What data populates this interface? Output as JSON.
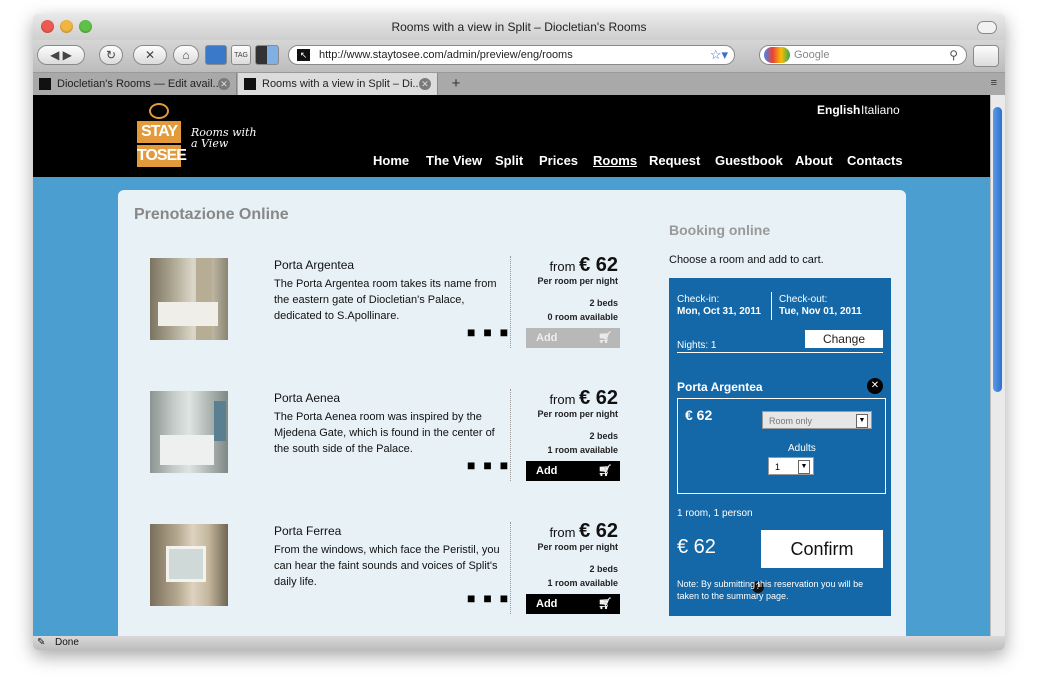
{
  "browser": {
    "window_title": "Rooms with a view in Split – Diocletian's Rooms",
    "url": "http://www.staytosee.com/admin/preview/eng/rooms",
    "search_placeholder": "Google",
    "tabs": [
      {
        "label": "Diocletian's Rooms — Edit avail..."
      },
      {
        "label": "Rooms with a view in Split – Di..."
      }
    ],
    "tab_add": "+",
    "status": "Done"
  },
  "site": {
    "logo_line1": "STAY",
    "logo_line2": "TOSEE",
    "tagline": "Rooms with a View",
    "languages": [
      "English",
      "Italiano"
    ],
    "nav": [
      "Home",
      "The View",
      "Split",
      "Prices",
      "Rooms",
      "Request",
      "Guestbook",
      "About",
      "Contacts"
    ],
    "nav_active": "Rooms"
  },
  "main": {
    "heading": "Prenotazione Online",
    "rooms": [
      {
        "name": "Porta Argentea",
        "desc": "The Porta Argentea room takes its name from the eastern gate of Diocletian's Palace, dedicated to S.Apollinare.",
        "from_label": "from",
        "price": "€ 62",
        "per": "Per room per night",
        "beds": "2 beds",
        "available": "0 room available",
        "add": "Add",
        "disabled": true
      },
      {
        "name": "Porta Aenea",
        "desc": "The Porta Aenea room was inspired by the Mjedena Gate, which is found in the center of the south side of the Palace.",
        "from_label": "from",
        "price": "€ 62",
        "per": "Per room per night",
        "beds": "2 beds",
        "available": "1 room available",
        "add": "Add",
        "disabled": false
      },
      {
        "name": "Porta Ferrea",
        "desc": "From the windows, which face the Peristil, you can hear the faint sounds and voices of Split's daily life.",
        "from_label": "from",
        "price": "€ 62",
        "per": "Per room per night",
        "beds": "2 beds",
        "available": "1 room available",
        "add": "Add",
        "disabled": false
      }
    ],
    "more": "■ ■ ■"
  },
  "booking": {
    "title": "Booking online",
    "subtitle": "Choose a room and add to cart.",
    "checkin_label": "Check-in:",
    "checkin_date": "Mon, Oct 31, 2011",
    "checkout_label": "Check-out:",
    "checkout_date": "Tue, Nov 01, 2011",
    "nights": "Nights: 1",
    "change": "Change",
    "room_name": "Porta Argentea",
    "room_price": "€ 62",
    "board": "Room only",
    "adults_label": "Adults",
    "adults_value": "1",
    "summary": "1 room, 1 person",
    "total": "€ 62",
    "confirm": "Confirm",
    "note": "Note: By submitting this reservation you will be taken to the summary page."
  },
  "colors": {
    "page_bg": "#4b9ed0",
    "panel_bg": "#e8f1f6",
    "booking_bg": "#1568a8",
    "header_bg": "#000000",
    "logo_orange": "#e39a3b"
  }
}
